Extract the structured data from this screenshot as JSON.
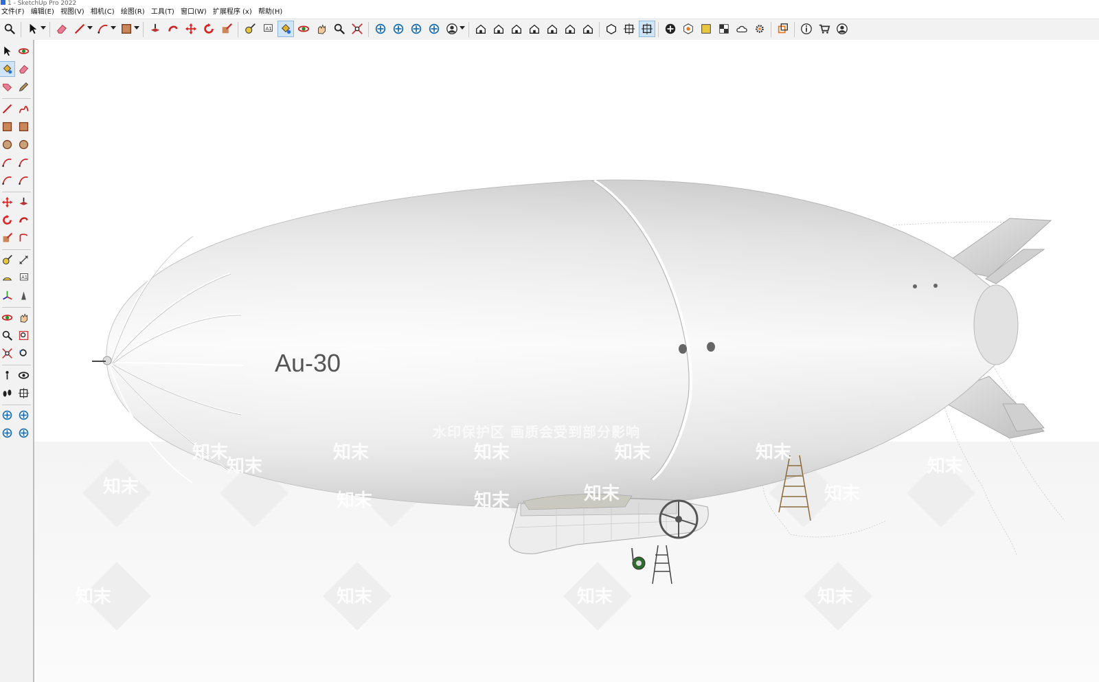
{
  "window": {
    "title": "1 - SketchUp Pro 2022"
  },
  "menu": [
    "文件(F)",
    "编辑(E)",
    "视图(V)",
    "相机(C)",
    "绘图(R)",
    "工具(T)",
    "窗口(W)",
    "扩展程序 (x)",
    "帮助(H)"
  ],
  "model": {
    "label": "Au-30"
  },
  "watermark": {
    "text": "水印保护区  画质会受到部分影响",
    "logo": [
      "知末",
      "知末",
      "知末",
      "知末",
      "知末",
      "知末",
      "知末",
      "知末",
      "知末",
      "知末",
      "知末",
      "知末",
      "知末",
      "知末",
      "知末",
      "知末"
    ]
  },
  "toolbar_icons": [
    "zoom-icon",
    "select-icon",
    "eraser-icon",
    "line-icon",
    "arc-icon",
    "rectangle-icon",
    "push-pull-icon",
    "follow-me-icon",
    "move-icon",
    "rotate-icon",
    "scale-icon",
    "tape-measure-icon",
    "text-icon",
    "paint-bucket-icon",
    "orbit-icon",
    "pan-icon",
    "zoom-tool-icon",
    "zoom-extents-icon",
    "warehouse-icon",
    "extension-warehouse-icon",
    "layout-icon",
    "style-builder-icon",
    "account-icon",
    "iso-view-icon",
    "top-view-icon",
    "front-view-icon",
    "right-view-icon",
    "back-view-icon",
    "left-view-icon",
    "bottom-view-icon",
    "solid-tools-icon",
    "section-plane-icon",
    "display-section-icon",
    "add-location-icon",
    "photo-texture-icon",
    "sandbox-icon",
    "checker-icon",
    "cloud-icon",
    "settings-icon",
    "dynamic-components-icon",
    "info-icon",
    "cart-icon",
    "profile-icon"
  ],
  "left_tools": [
    "select-icon",
    "orbit-icon",
    "paint-bucket-icon",
    "eraser-icon",
    "tag-tool-icon",
    "eyedropper-icon",
    "line-icon",
    "freehand-icon",
    "rectangle-icon",
    "rotated-rectangle-icon",
    "circle-icon",
    "polygon-icon",
    "arc-icon",
    "two-point-arc-icon",
    "three-point-arc-icon",
    "pie-icon",
    "move-icon",
    "push-pull-icon",
    "rotate-icon",
    "follow-me-icon",
    "scale-icon",
    "offset-icon",
    "tape-measure-icon",
    "dimension-icon",
    "protractor-icon",
    "text-icon",
    "axes-icon",
    "3d-text-icon",
    "orbit-tool-icon",
    "pan-icon",
    "zoom-icon",
    "zoom-window-icon",
    "zoom-extents-icon",
    "previous-view-icon",
    "position-camera-icon",
    "look-around-icon",
    "walk-icon",
    "section-plane-icon",
    "warehouse-icon",
    "extension-warehouse-icon",
    "layout-icon",
    "style-builder-icon"
  ]
}
